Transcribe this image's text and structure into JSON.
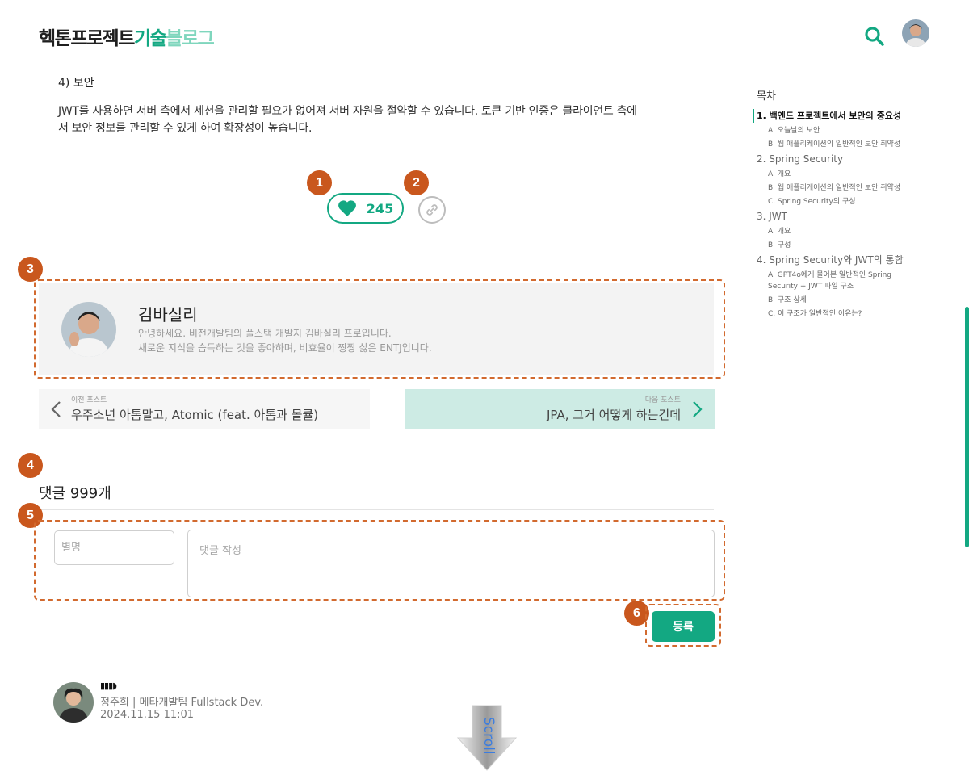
{
  "header": {
    "logo_part1": "헥톤프로젝트",
    "logo_part2": "기술",
    "logo_part3": "블로그",
    "search_icon": "search-icon",
    "avatar": "user-avatar"
  },
  "article": {
    "section_heading": "4) 보안",
    "body_line1": "JWT를 사용하면 서버 측에서 세션을 관리할 필요가 없어져 서버 자원을 절약할 수 있습니다. 토큰 기반 인증은 클라이언트 측에",
    "body_line2": "서 보안 정보를 관리할 수 있게 하여 확장성이 높습니다."
  },
  "reactions": {
    "like_count": "245",
    "like_icon": "heart-icon",
    "share_icon": "link-icon"
  },
  "markers": [
    "1",
    "2",
    "3",
    "4",
    "5",
    "6"
  ],
  "author": {
    "name": "김바실리",
    "bio_line1": "안녕하세요. 비전개발팀의 풀스택 개발지 김바실리 프로입니다.",
    "bio_line2": "새로운 지식을 습득하는 것을 좋아하며, 비효율이 찡짱 싫은 ENTJ입니다."
  },
  "post_nav": {
    "prev_label": "이전 포스트",
    "prev_title": "우주소년 아톰말고, Atomic (feat. 아톰과 몰큘)",
    "next_label": "다음 포스트",
    "next_title": "JPA, 그거 어떻게 하는건데"
  },
  "comments": {
    "title": "댓글 999개",
    "nickname_placeholder": "별명",
    "comment_placeholder": "댓글 작성",
    "submit_label": "등록",
    "entry": {
      "nickname": "▮▮▮◗",
      "meta": "정주희 | 메타개발팀 Fullstack Dev.",
      "date": "2024.11.15 11:01"
    }
  },
  "scroll_label": "Scroll",
  "toc": {
    "title": "목차",
    "sections": [
      {
        "label": "1. 백엔드 프로젝트에서 보안의 중요성",
        "active": true,
        "items": [
          "A. 오늘날의 보안",
          "B. 웹 애플리케이션의 일반적인 보안 취약성"
        ]
      },
      {
        "label": "2. Spring Security",
        "active": false,
        "items": [
          "A. 개요",
          "B. 웹 애플리케이션의 일반적인 보안 취약성",
          "C. Spring Security의 구성"
        ]
      },
      {
        "label": "3. JWT",
        "active": false,
        "items": [
          "A. 개요",
          "B. 구성"
        ]
      },
      {
        "label": "4. Spring Security와 JWT의 통합",
        "active": false,
        "items": [
          "A. GPT4o에게 물어본 일반적인 Spring Security + JWT 파일 구조",
          "B. 구조 상세",
          "C. 이 구조가 일반적인 이유는?"
        ]
      }
    ]
  },
  "colors": {
    "accent": "#13a882",
    "marker": "#c9571d",
    "next_post_bg": "#cdebe4"
  }
}
